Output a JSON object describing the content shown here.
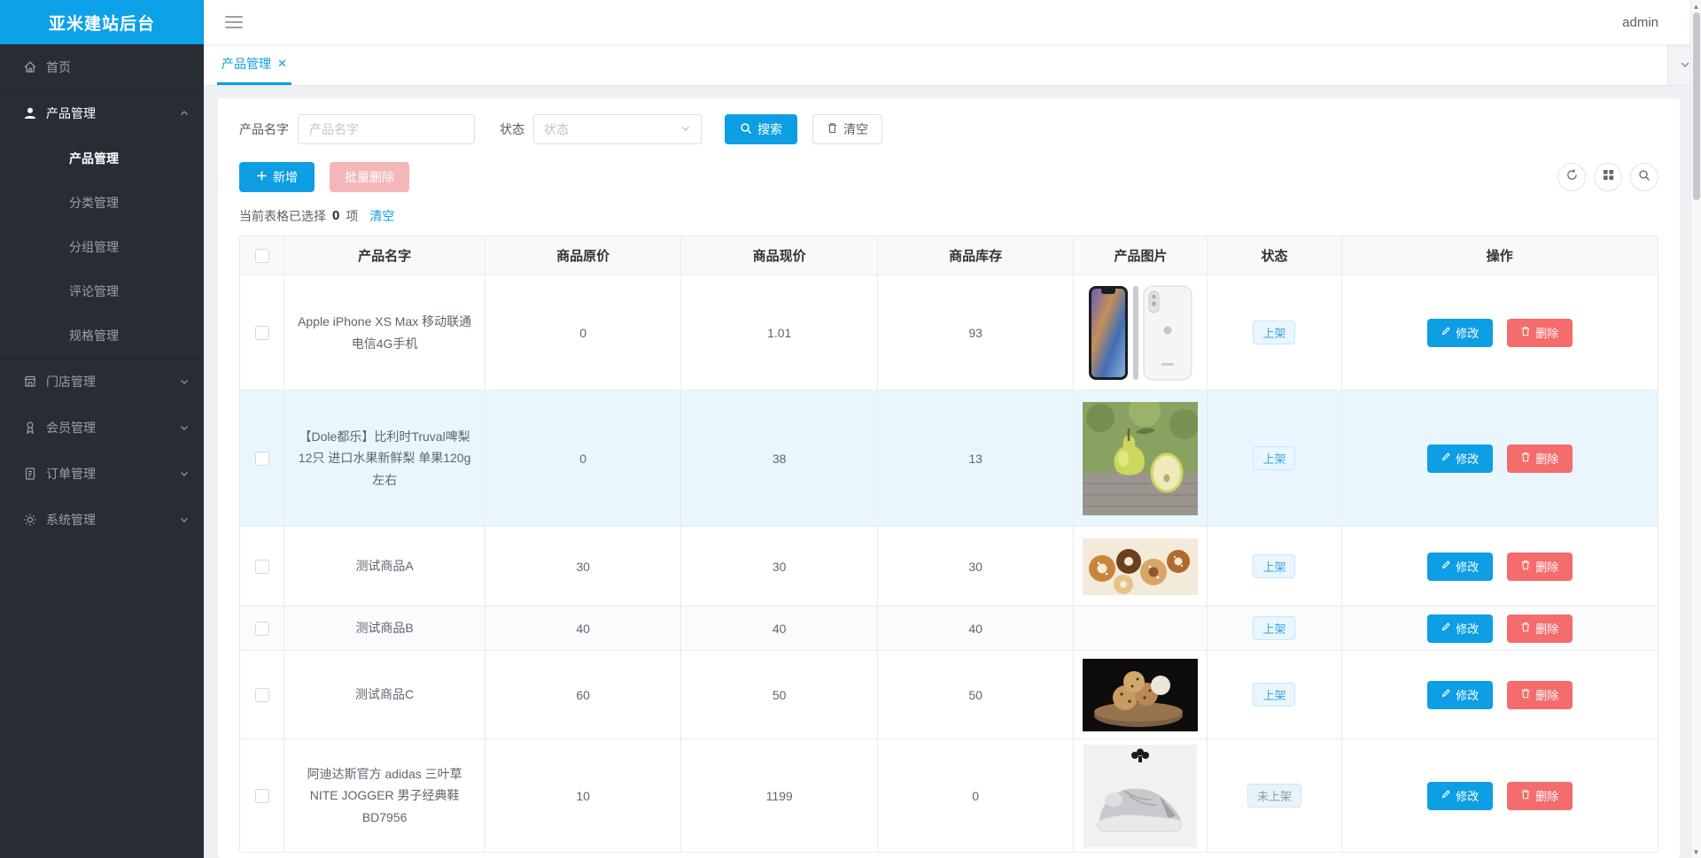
{
  "app": {
    "logo_text": "亚米建站后台",
    "username": "admin"
  },
  "colors": {
    "primary": "#0d9ee4",
    "danger": "#f56c6c",
    "danger_disabled": "#f3b7b7",
    "sidebar_bg": "#272c35",
    "page_bg": "#eef0f3",
    "tag_on_text": "#3aa2e3",
    "tag_off_text": "#8e9ba7"
  },
  "sidebar": {
    "items": [
      {
        "label": "首页",
        "icon": "home-icon"
      },
      {
        "label": "产品管理",
        "icon": "user-icon",
        "expanded": true,
        "children": [
          {
            "label": "产品管理",
            "active": true
          },
          {
            "label": "分类管理"
          },
          {
            "label": "分组管理"
          },
          {
            "label": "评论管理"
          },
          {
            "label": "规格管理"
          }
        ]
      },
      {
        "label": "门店管理",
        "icon": "shop-icon"
      },
      {
        "label": "会员管理",
        "icon": "member-icon"
      },
      {
        "label": "订单管理",
        "icon": "order-icon"
      },
      {
        "label": "系统管理",
        "icon": "gear-icon"
      }
    ]
  },
  "tabs": {
    "active_label": "产品管理"
  },
  "filters": {
    "name_label": "产品名字",
    "name_placeholder": "产品名字",
    "status_label": "状态",
    "status_placeholder": "状态",
    "search_label": "搜索",
    "clear_label": "清空"
  },
  "toolbar": {
    "add_label": "新增",
    "batch_delete_label": "批量删除",
    "selection_prefix": "当前表格已选择",
    "selection_count": "0",
    "selection_suffix": "项",
    "clear_link": "清空"
  },
  "table": {
    "headers": [
      "产品名字",
      "商品原价",
      "商品现价",
      "商品库存",
      "产品图片",
      "状态",
      "操作"
    ],
    "edit_label": "修改",
    "delete_label": "删除",
    "rows": [
      {
        "name": "Apple iPhone XS Max 移动联通电信4G手机",
        "original_price": "0",
        "price": "1.01",
        "stock": "93",
        "image": "iphone-xs-max",
        "status": "上架"
      },
      {
        "name": "【Dole都乐】比利时Truval啤梨12只 进口水果新鲜梨 单果120g左右",
        "original_price": "0",
        "price": "38",
        "stock": "13",
        "image": "dole-pears",
        "status": "上架"
      },
      {
        "name": "测试商品A",
        "original_price": "30",
        "price": "30",
        "stock": "30",
        "image": "assorted-cookies",
        "status": "上架"
      },
      {
        "name": "测试商品B",
        "original_price": "40",
        "price": "40",
        "stock": "40",
        "image": "",
        "status": "上架"
      },
      {
        "name": "测试商品C",
        "original_price": "60",
        "price": "50",
        "stock": "50",
        "image": "cookie-dough",
        "status": "上架"
      },
      {
        "name": "阿迪达斯官方 adidas 三叶草 NITE JOGGER 男子经典鞋BD7956",
        "original_price": "10",
        "price": "1199",
        "stock": "0",
        "image": "adidas-sneaker",
        "status": "未上架"
      }
    ]
  }
}
